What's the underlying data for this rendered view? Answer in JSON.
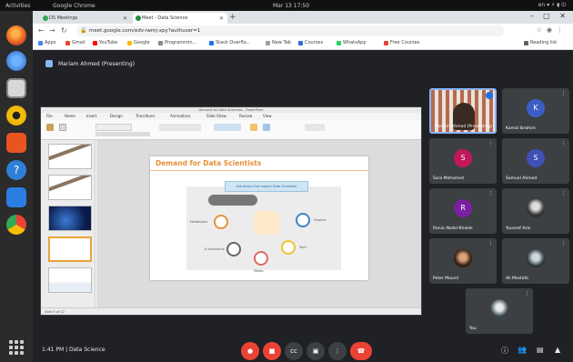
{
  "topbar": {
    "activities": "Activities",
    "app_name": "Google Chrome",
    "clock": "Mar 13  17:50",
    "tray": "en ▾   ⚡ ◖ ⏻"
  },
  "dock": {
    "apps": [
      "firefox",
      "thunderbird",
      "files",
      "rhythmbox",
      "software-center",
      "help",
      "writer",
      "chrome"
    ]
  },
  "browser": {
    "tabs": [
      {
        "label": "DS Meetings",
        "favicon_color": "#34a853"
      },
      {
        "label": "Meet - Data Science",
        "favicon_color": "#1e8e3e",
        "active": true
      }
    ],
    "newtab": "+",
    "window_controls": "– ▢ ✕",
    "omnibox": "meet.google.com/edv-iwmj-xpy?authuser=1",
    "bookmarks": [
      {
        "label": "Apps",
        "color": "#4285f4"
      },
      {
        "label": "Gmail",
        "color": "#ea4335"
      },
      {
        "label": "YouTube",
        "color": "#ff0000"
      },
      {
        "label": "Google",
        "color": "#fbbc05"
      },
      {
        "label": "Programmin...",
        "color": "#888888"
      },
      {
        "label": "Stack Overflo...",
        "color": "#1a73e8"
      },
      {
        "label": "New Tab",
        "color": "#9aa0a6"
      },
      {
        "label": "Courses",
        "color": "#3367d6"
      },
      {
        "label": "WhatsApp",
        "color": "#25d366"
      },
      {
        "label": "Free Courses",
        "color": "#ea4335"
      },
      {
        "label": "Reading list",
        "color": "#5f6368"
      }
    ]
  },
  "meet": {
    "presenter_banner": "Mariam Ahmed (Presenting)",
    "slide": {
      "title": "Demand for Data Scientists",
      "banner": "Industries that require Data Scientists",
      "nodes": [
        "Healthcare",
        "Finance",
        "E-commerce",
        "Tech",
        "Media"
      ]
    },
    "ppt": {
      "titlebar": "Demand for Data Scientists - PowerPoint",
      "menu": [
        "File",
        "Home",
        "Insert",
        "Design",
        "Transitions",
        "Animations",
        "Slide Show",
        "Review",
        "View"
      ],
      "status": "Slide 5 of 12"
    },
    "participants": [
      {
        "name": "Mariam Ahmed (Presenting)",
        "initial": "",
        "color": "#6b6257",
        "video": true
      },
      {
        "name": "Kamal Ibrahim",
        "initial": "K",
        "color": "#3b5ec6"
      },
      {
        "name": "Sara Mohamed",
        "initial": "S",
        "color": "#c2185b"
      },
      {
        "name": "Samuel Ahmed",
        "initial": "S",
        "color": "#3f51b5"
      },
      {
        "name": "Rania Abdel-Khalek",
        "initial": "R",
        "color": "#7b1fa2"
      },
      {
        "name": "Youssef Aziz",
        "initial": "",
        "color": "#555555"
      },
      {
        "name": "Peter Mounir",
        "initial": "",
        "color": "#8a3a1e"
      },
      {
        "name": "Ali Mostafa",
        "initial": "",
        "color": "#47545c"
      },
      {
        "name": "You",
        "initial": "",
        "color": "#5a6770"
      }
    ],
    "bottom": {
      "meeting_info": "1:41 PM  |  Data Science",
      "controls": [
        "mic-off",
        "camera-off",
        "captions",
        "present",
        "more",
        "hang-up"
      ],
      "right": [
        "info",
        "people",
        "chat",
        "activities"
      ]
    }
  }
}
